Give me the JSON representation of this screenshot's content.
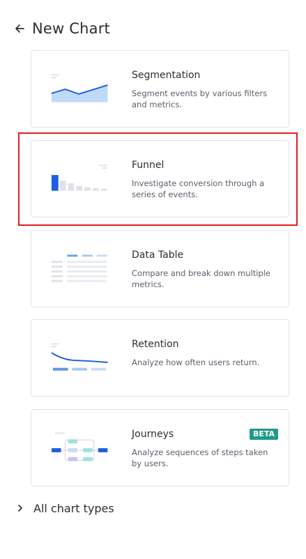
{
  "header": {
    "title": "New Chart"
  },
  "cards": [
    {
      "name": "Segmentation",
      "description": "Segment events by various filters and metrics."
    },
    {
      "name": "Funnel",
      "description": "Investigate conversion through a series of events."
    },
    {
      "name": "Data Table",
      "description": "Compare and break down multiple metrics."
    },
    {
      "name": "Retention",
      "description": "Analyze how often users return."
    },
    {
      "name": "Journeys",
      "description": "Analyze sequences of steps taken by users.",
      "badge": "BETA"
    }
  ],
  "footer": {
    "label": "All chart types"
  },
  "colors": {
    "accent": "#1e5fe0",
    "accent_light": "#bfdaf7",
    "badge": "#1f9a8a",
    "selection_outline": "#e01e1e"
  },
  "icons": {
    "back": "arrow-left-icon",
    "expand": "chevron-right-icon"
  }
}
